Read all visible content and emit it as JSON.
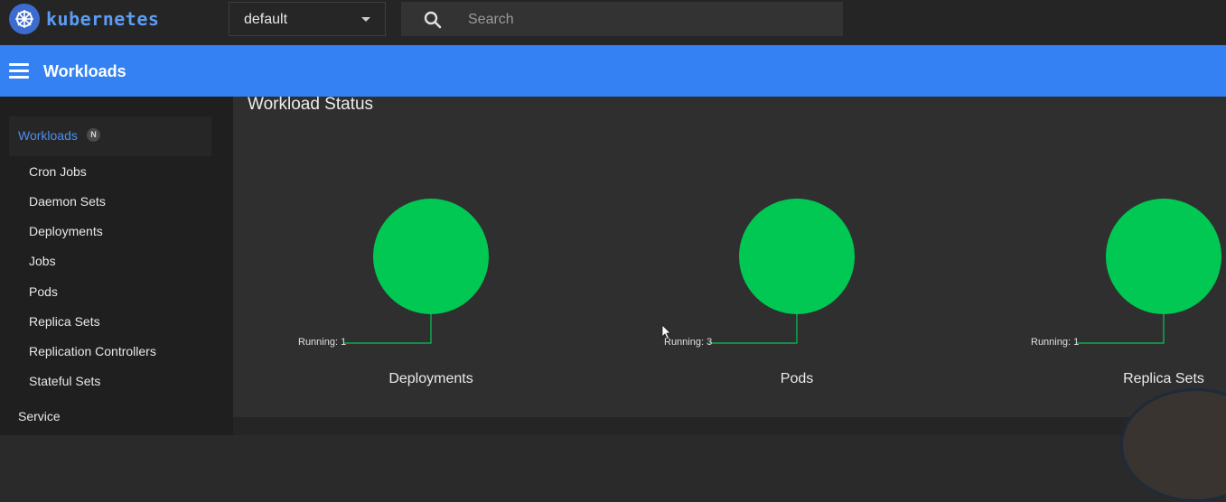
{
  "app": {
    "name": "kubernetes"
  },
  "topbar": {
    "namespace": "default",
    "search_placeholder": "Search"
  },
  "header": {
    "title": "Workloads"
  },
  "sidebar": {
    "section": {
      "label": "Workloads",
      "badge": "N"
    },
    "items": [
      {
        "label": "Cron Jobs"
      },
      {
        "label": "Daemon Sets"
      },
      {
        "label": "Deployments"
      },
      {
        "label": "Jobs"
      },
      {
        "label": "Pods"
      },
      {
        "label": "Replica Sets"
      },
      {
        "label": "Replication Controllers"
      },
      {
        "label": "Stateful Sets"
      }
    ],
    "next_section": "Service"
  },
  "main": {
    "title": "Workload Status",
    "charts": [
      {
        "name": "Deployments",
        "running_label": "Running: 1",
        "running": 1,
        "color": "#00c853"
      },
      {
        "name": "Pods",
        "running_label": "Running: 3",
        "running": 3,
        "color": "#00c853"
      },
      {
        "name": "Replica Sets",
        "running_label": "Running: 1",
        "running": 1,
        "color": "#00c853"
      }
    ]
  },
  "chart_data": [
    {
      "type": "pie",
      "title": "Deployments",
      "labels": [
        "Running"
      ],
      "values": [
        1
      ],
      "colors": [
        "#00c853"
      ]
    },
    {
      "type": "pie",
      "title": "Pods",
      "labels": [
        "Running"
      ],
      "values": [
        3
      ],
      "colors": [
        "#00c853"
      ]
    },
    {
      "type": "pie",
      "title": "Replica Sets",
      "labels": [
        "Running"
      ],
      "values": [
        1
      ],
      "colors": [
        "#00c853"
      ]
    }
  ]
}
